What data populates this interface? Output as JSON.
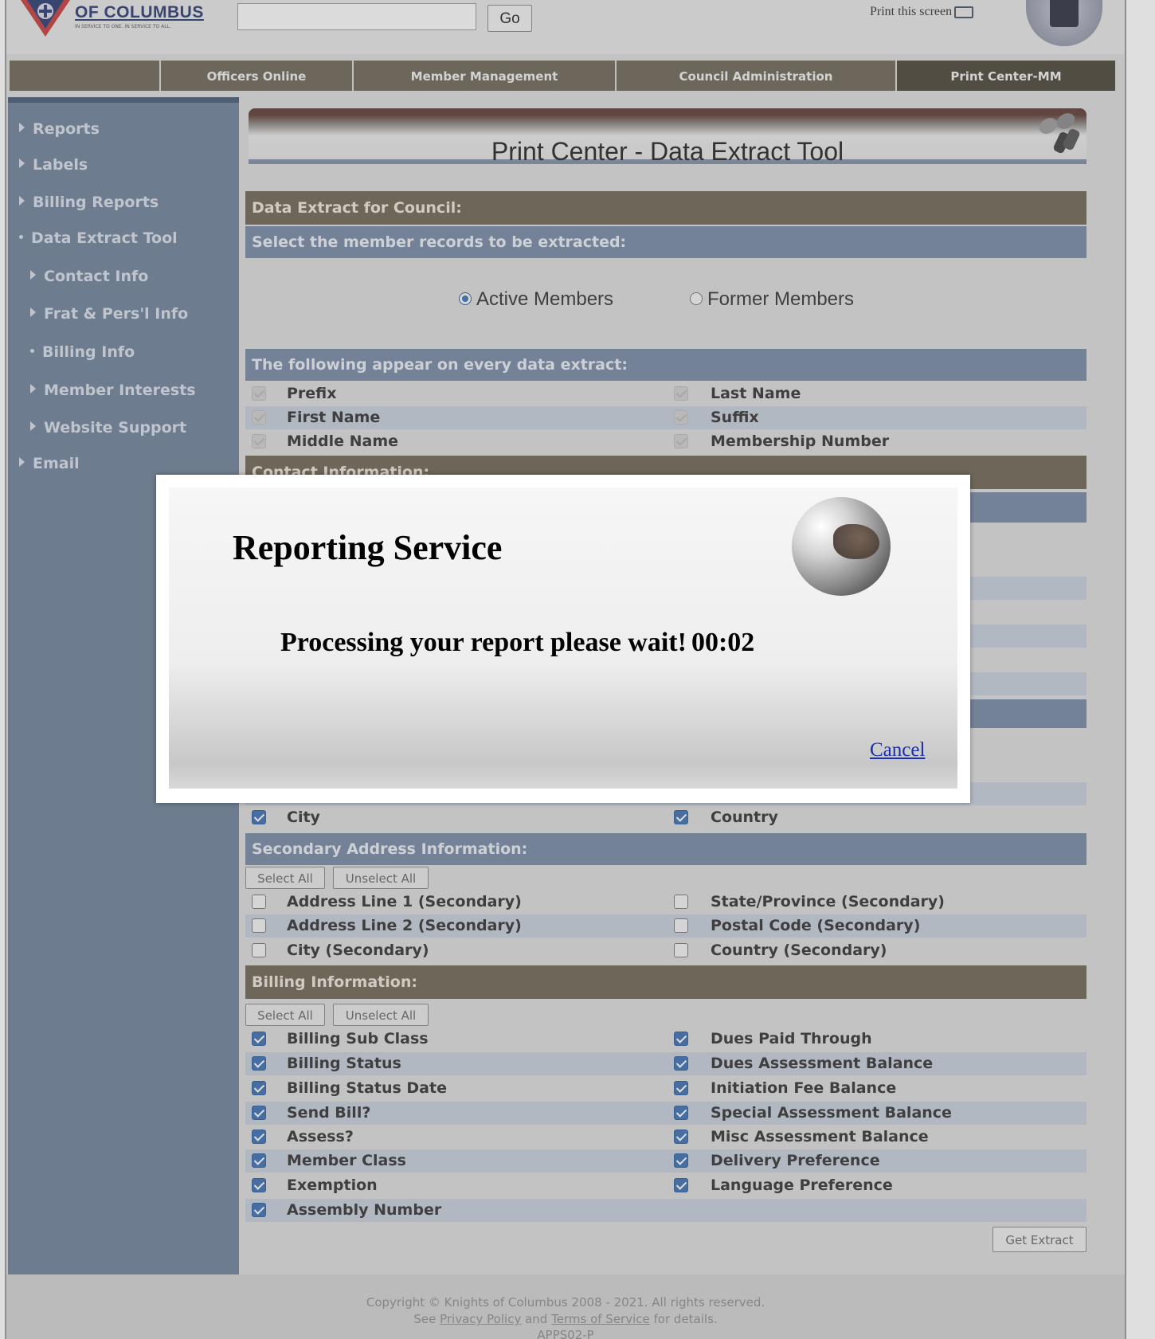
{
  "header": {
    "org_name": "OF COLUMBUS",
    "org_tagline": "IN SERVICE TO ONE. IN SERVICE TO ALL.",
    "search_value": "",
    "go_label": "Go",
    "print_label": "Print this screen",
    "badge_icon": "expert-badge"
  },
  "nav": {
    "tabs": [
      {
        "label": ""
      },
      {
        "label": "Officers Online"
      },
      {
        "label": "Member Management"
      },
      {
        "label": "Council Administration"
      },
      {
        "label": "Print Center-MM"
      }
    ],
    "active_color": "#4b4438",
    "tab_color": "#6d6556"
  },
  "sidebar": {
    "items": [
      {
        "label": "Reports",
        "marker": "triangle"
      },
      {
        "label": "Labels",
        "marker": "triangle"
      },
      {
        "label": "Billing Reports",
        "marker": "triangle"
      },
      {
        "label": "Data Extract Tool",
        "marker": "dot"
      },
      {
        "label": "Contact Info",
        "marker": "triangle"
      },
      {
        "label": "Frat & Pers'l Info",
        "marker": "triangle"
      },
      {
        "label": "Billing Info",
        "marker": "dot"
      },
      {
        "label": "Member Interests",
        "marker": "triangle"
      },
      {
        "label": "Website Support",
        "marker": "triangle"
      },
      {
        "label": "Email",
        "marker": "triangle"
      }
    ]
  },
  "main": {
    "page_title": "Print Center - Data Extract Tool",
    "data_extract_header": "Data Extract for Council:",
    "select_records_header": "Select the member records to be extracted:",
    "radio_active": "Active Members",
    "radio_former": "Former Members",
    "radio_selected": "Active Members",
    "every_extract_header": "The following appear on every data extract:",
    "every_extract_rows": [
      [
        "Prefix",
        "Last Name"
      ],
      [
        "First Name",
        "Suffix"
      ],
      [
        "Middle Name",
        "Membership Number"
      ]
    ],
    "contact_header": "Contact Information:",
    "city_label": "City",
    "country_label": "Country",
    "secondary_header": "Secondary Address Information:",
    "select_all": "Select All",
    "unselect_all": "Unselect All",
    "secondary_rows": [
      [
        "Address Line 1 (Secondary)",
        "State/Province (Secondary)"
      ],
      [
        "Address Line 2 (Secondary)",
        "Postal Code (Secondary)"
      ],
      [
        "City (Secondary)",
        "Country (Secondary)"
      ]
    ],
    "billing_header": "Billing Information:",
    "billing_rows": [
      [
        "Billing Sub Class",
        "Dues Paid Through"
      ],
      [
        "Billing Status",
        "Dues Assessment Balance"
      ],
      [
        "Billing Status Date",
        "Initiation Fee Balance"
      ],
      [
        "Send Bill?",
        "Special Assessment Balance"
      ],
      [
        "Assess?",
        "Misc Assessment Balance"
      ],
      [
        "Member Class",
        "Delivery Preference"
      ],
      [
        "Exemption",
        "Language Preference"
      ],
      [
        "Assembly Number",
        ""
      ]
    ],
    "get_extract": "Get Extract"
  },
  "footer": {
    "copyright": "Copyright © Knights of Columbus 2008 - 2021. All rights reserved.",
    "see": "See",
    "privacy": "Privacy Policy",
    "and": "and",
    "terms": "Terms of Service",
    "details": "for details.",
    "server": "APPS02-P"
  },
  "modal": {
    "title": "Reporting Service",
    "message": "Processing your report please wait!",
    "timer": "00:02",
    "cancel": "Cancel",
    "icon": "globe-icon"
  }
}
